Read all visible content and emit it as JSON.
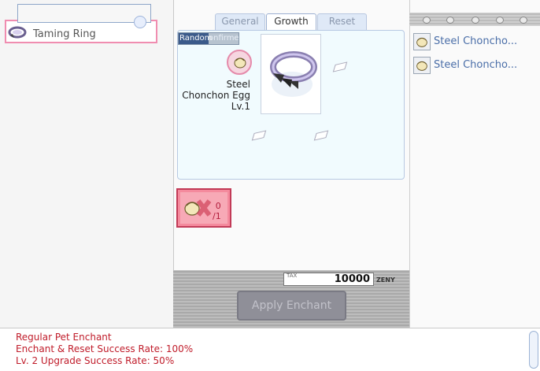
{
  "ring_list": {
    "selected_item": "Taming Ring"
  },
  "tabs": [
    {
      "label": "General"
    },
    {
      "label": "Growth"
    },
    {
      "label": "Reset"
    }
  ],
  "growth": {
    "random_bar_text_a": "Random",
    "random_bar_text_b": "onfirme",
    "egg_name_line1": "Steel",
    "egg_name_line2": "Chonchon Egg",
    "egg_level": "Lv.1"
  },
  "material": {
    "have": "0",
    "need": "/1"
  },
  "tax": {
    "label": "TAX",
    "value": "10000",
    "currency": "ZENY"
  },
  "apply_button_label": "Apply Enchant",
  "right_list": {
    "items": [
      {
        "label": "Steel Choncho..."
      },
      {
        "label": "Steel Choncho..."
      }
    ]
  },
  "info": {
    "line1": "Regular Pet Enchant",
    "line2": "Enchant & Reset Success Rate: 100%",
    "line3": "Lv. 2 Upgrade Success Rate: 50%"
  },
  "colors": {
    "info_text": "#c01c2a",
    "list_text": "#4a6ea8",
    "material_slot": "#f48a9d"
  }
}
